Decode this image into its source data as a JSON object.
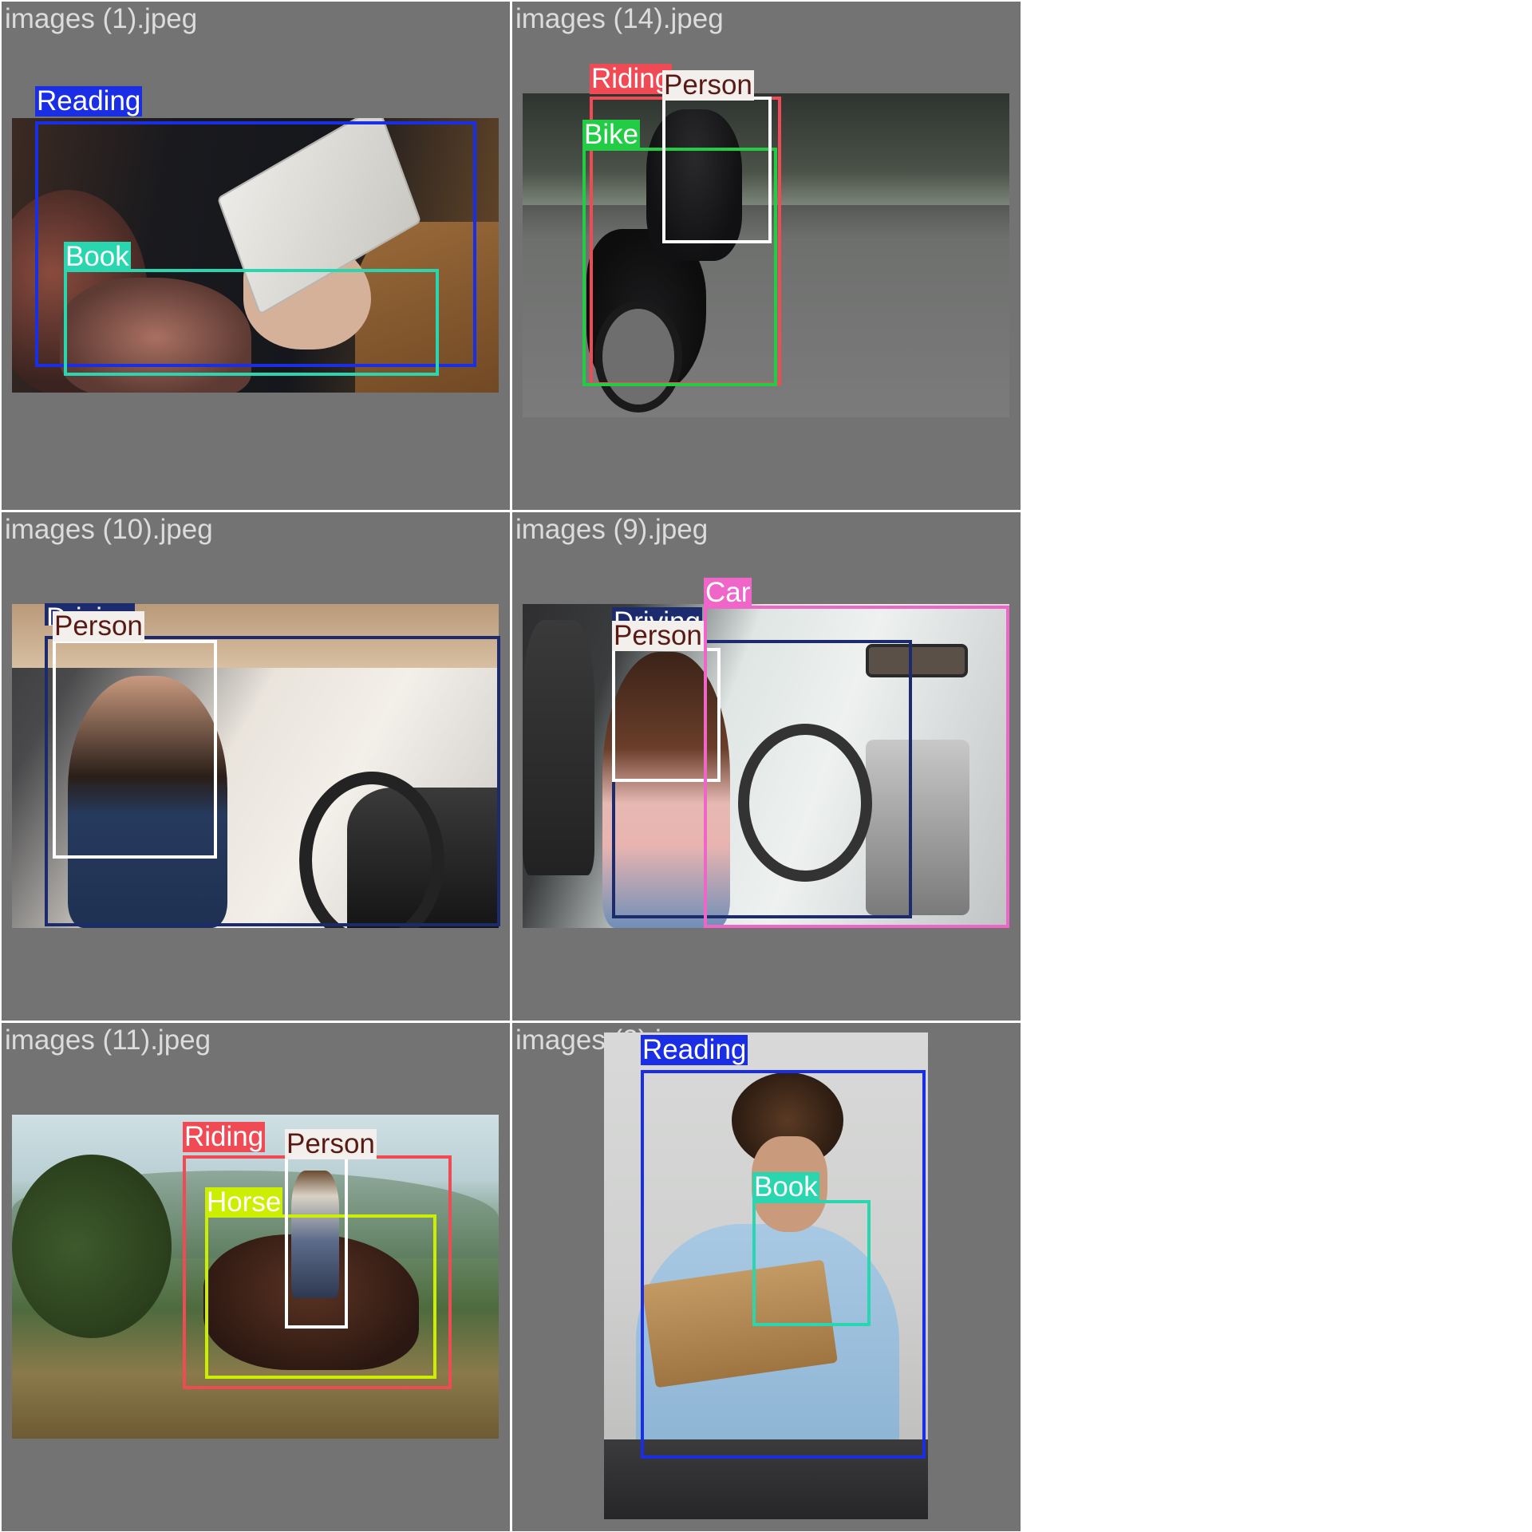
{
  "tiles": [
    {
      "title": "images (1).jpeg",
      "boxes": [
        {
          "label": "Reading",
          "color": "#1a2ee6"
        },
        {
          "label": "Book",
          "color": "#2ad6b0"
        }
      ]
    },
    {
      "title": "images (14).jpeg",
      "boxes": [
        {
          "label": "Riding",
          "color": "#f04a55"
        },
        {
          "label": "Person",
          "color": "#ffffff"
        },
        {
          "label": "Bike",
          "color": "#22cc44"
        }
      ]
    },
    {
      "title": "images (10).jpeg",
      "boxes": [
        {
          "label": "Driving",
          "color": "#1c2a6e"
        },
        {
          "label": "Person",
          "color": "#ffffff"
        }
      ]
    },
    {
      "title": "images (9).jpeg",
      "boxes": [
        {
          "label": "Driving",
          "color": "#1c2a6e"
        },
        {
          "label": "Person",
          "color": "#ffffff"
        },
        {
          "label": "Car",
          "color": "#f066c8"
        }
      ]
    },
    {
      "title": "images (11).jpeg",
      "boxes": [
        {
          "label": "Riding",
          "color": "#f04a55"
        },
        {
          "label": "Person",
          "color": "#ffffff"
        },
        {
          "label": "Horse",
          "color": "#ccee00"
        }
      ]
    },
    {
      "title": "images (2).jpeg",
      "boxes": [
        {
          "label": "Reading",
          "color": "#1a2ee6"
        },
        {
          "label": "Book",
          "color": "#2ad6b0"
        }
      ]
    }
  ],
  "colors": {
    "tile_background": "#737373",
    "title_text": "#dcdcdc",
    "page_background": "#ffffff"
  }
}
